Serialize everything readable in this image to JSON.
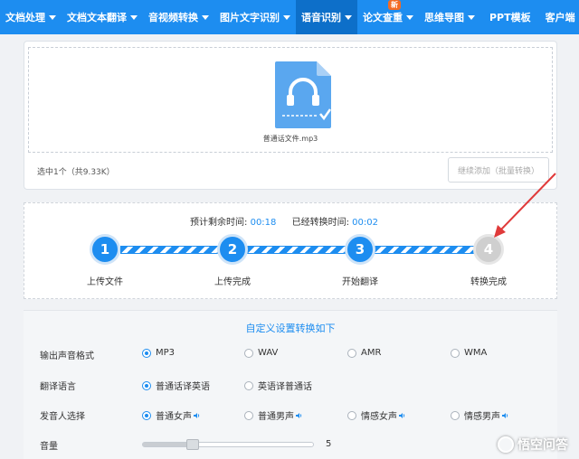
{
  "nav": {
    "items": [
      {
        "label": "文档处理"
      },
      {
        "label": "文档文本翻译"
      },
      {
        "label": "音视频转换"
      },
      {
        "label": "图片文字识别"
      },
      {
        "label": "语音识别"
      },
      {
        "label": "论文查重",
        "badge": "新"
      },
      {
        "label": "思维导图"
      },
      {
        "label": "PPT模板"
      },
      {
        "label": "客户端"
      }
    ],
    "active_index": 4
  },
  "upload": {
    "file_name": "普通话文件.mp3",
    "selected_info": "选中1个（共9.33K）",
    "add_button": "继续添加（批量转换）"
  },
  "progress": {
    "remaining_label": "预计剩余时间:",
    "remaining_value": "00:18",
    "elapsed_label": "已经转换时间:",
    "elapsed_value": "00:02",
    "steps": [
      {
        "number": "1",
        "label": "上传文件",
        "done": true
      },
      {
        "number": "2",
        "label": "上传完成",
        "done": true
      },
      {
        "number": "3",
        "label": "开始翻译",
        "done": true
      },
      {
        "number": "4",
        "label": "转换完成",
        "done": false
      }
    ]
  },
  "settings": {
    "title": "自定义设置转换如下",
    "output_format": {
      "label": "输出声音格式",
      "options": [
        "MP3",
        "WAV",
        "AMR",
        "WMA"
      ],
      "selected": "MP3"
    },
    "language": {
      "label": "翻译语言",
      "options": [
        "普通话译英语",
        "英语译普通话"
      ],
      "selected": "普通话译英语"
    },
    "speaker": {
      "label": "发音人选择",
      "options": [
        "普通女声",
        "普通男声",
        "情感女声",
        "情感男声"
      ],
      "selected": "普通女声"
    },
    "volume": {
      "label": "音量",
      "value": "5",
      "fraction": 0.29
    }
  },
  "watermark": "悟空问答",
  "colors": {
    "accent": "#1d8df0",
    "nav_active": "#0d6fc9",
    "badge": "#f46b23",
    "arrow": "#e03a3a"
  }
}
